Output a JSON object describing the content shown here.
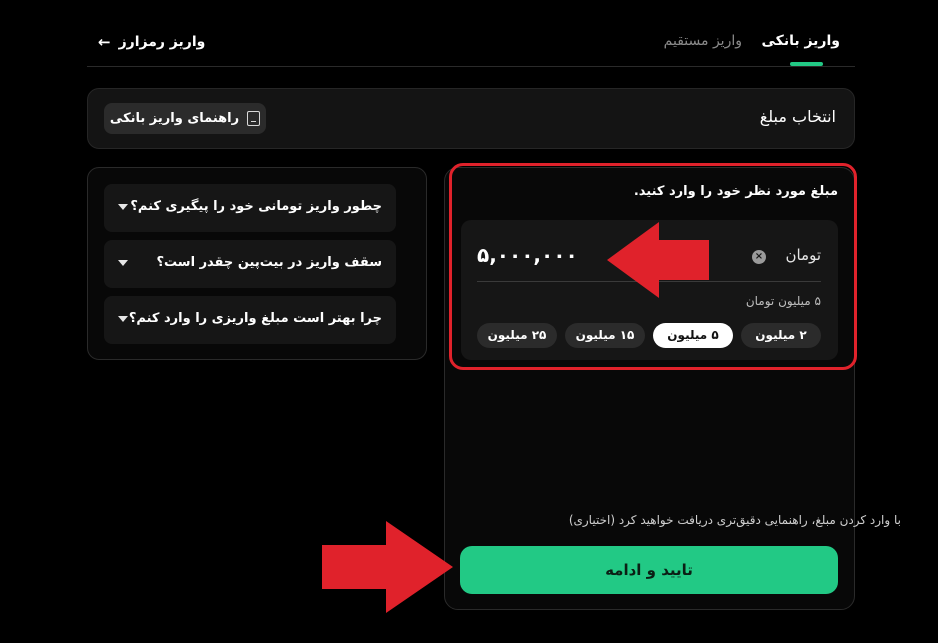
{
  "tabs": {
    "active": "واریز بانکی",
    "inactive": "واریز مستقیم",
    "back_link": "واریز رمزارز",
    "back_arrow": "←"
  },
  "header": {
    "title": "انتخاب مبلغ",
    "guide_button": "راهنمای واریز بانکی"
  },
  "faq": {
    "items": [
      {
        "question": "چطور واریز تومانی خود را پیگیری کنم؟"
      },
      {
        "question": "سقف واریز در بیت‌پین چقدر است؟"
      },
      {
        "question": "چرا بهتر است مبلغ واریزی را وارد کنم؟"
      }
    ]
  },
  "amount": {
    "prompt": "مبلغ مورد نظر خود را وارد کنید.",
    "currency": "تومان",
    "clear_symbol": "×",
    "value": "۵,۰۰۰,۰۰۰",
    "words": "۵ میلیون تومان",
    "chips": [
      {
        "label": "۲ میلیون",
        "selected": false
      },
      {
        "label": "۵ میلیون",
        "selected": true
      },
      {
        "label": "۱۵ میلیون",
        "selected": false
      },
      {
        "label": "۲۵ میلیون",
        "selected": false
      }
    ]
  },
  "footer": {
    "hint": "با وارد کردن مبلغ، راهنمایی دقیق‌تری دریافت خواهید کرد (اختیاری)",
    "confirm_button": "تایید و ادامه"
  },
  "colors": {
    "accent": "#22c985",
    "annotation": "#e0222b",
    "background": "#000000"
  }
}
